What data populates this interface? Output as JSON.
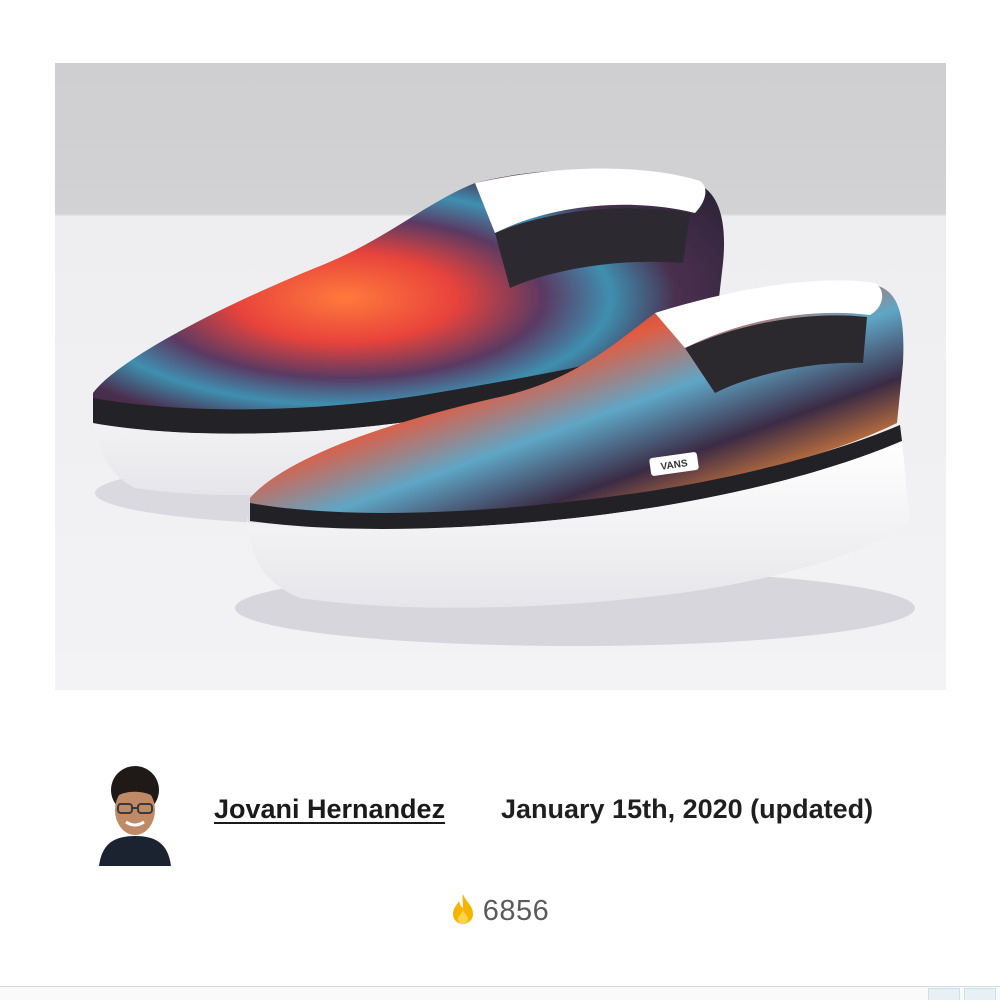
{
  "hero_image": {
    "icon": "vans-slip-on-shoes-photo",
    "brand_tag": "VANS"
  },
  "author": {
    "name": "Jovani Hernandez",
    "avatar_icon": "author-avatar"
  },
  "post": {
    "date": "January 15th, 2020 (updated)",
    "view_count": "6856",
    "view_icon": "flame-icon"
  },
  "colors": {
    "flame": "#f4b400",
    "text": "#1a1a1a",
    "muted": "#5b5b5b"
  }
}
